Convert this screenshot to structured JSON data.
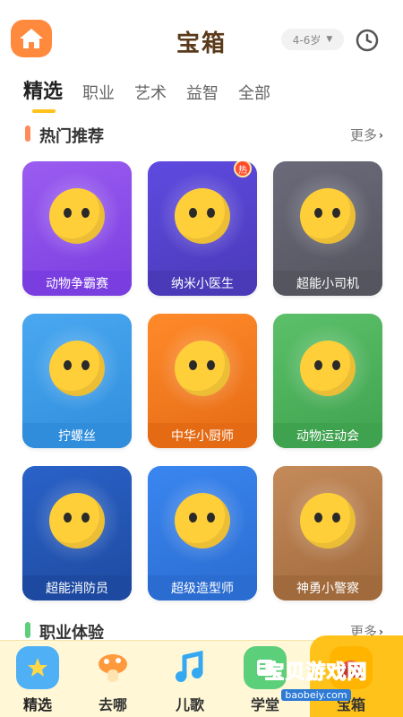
{
  "header": {
    "title": "宝箱",
    "age_filter": "4-6岁",
    "home_icon": "home-icon",
    "clock_icon": "clock-icon"
  },
  "tabs": [
    {
      "label": "精选",
      "active": true
    },
    {
      "label": "职业",
      "active": false
    },
    {
      "label": "艺术",
      "active": false
    },
    {
      "label": "益智",
      "active": false
    },
    {
      "label": "全部",
      "active": false
    }
  ],
  "sections": {
    "hot": {
      "title": "热门推荐",
      "more": "更多",
      "accent": "#ff8a5c"
    },
    "career": {
      "title": "职业体验",
      "more": "更多",
      "accent": "#5ccf7a"
    }
  },
  "cards": [
    {
      "label": "动物争霸赛",
      "bg": "#9b5cf0",
      "bar": "#7a3ee0",
      "badge": ""
    },
    {
      "label": "纳米小医生",
      "bg": "#5f4ae0",
      "bar": "#4a3ab8",
      "badge": "热"
    },
    {
      "label": "超能小司机",
      "bg": "#6a6a7a",
      "bar": "#55555f",
      "badge": ""
    },
    {
      "label": "拧螺丝",
      "bg": "#49a8f0",
      "bar": "#2f8ddc",
      "badge": ""
    },
    {
      "label": "中华小厨师",
      "bg": "#ff8a2a",
      "bar": "#e56a14",
      "badge": ""
    },
    {
      "label": "动物运动会",
      "bg": "#5cc06a",
      "bar": "#3fa24e",
      "badge": ""
    },
    {
      "label": "超能消防员",
      "bg": "#2a62c8",
      "bar": "#1d4aa0",
      "badge": ""
    },
    {
      "label": "超级造型师",
      "bg": "#3a86f0",
      "bar": "#2a6cd0",
      "badge": ""
    },
    {
      "label": "神勇小警察",
      "bg": "#c48a5a",
      "bar": "#a06a3c",
      "badge": ""
    }
  ],
  "bottom_nav": [
    {
      "label": "精选",
      "icon": "star-icon",
      "color": "#4fb0f5",
      "active": true
    },
    {
      "label": "去哪",
      "icon": "mushroom-icon",
      "color": "#ff9a3c",
      "active": false
    },
    {
      "label": "儿歌",
      "icon": "music-note-icon",
      "color": "#34a8f0",
      "active": false
    },
    {
      "label": "学堂",
      "icon": "book-icon",
      "color": "#5ccf7a",
      "active": false
    },
    {
      "label": "宝箱",
      "icon": "treasure-box-icon",
      "color": "#ffc21a",
      "active": false
    }
  ],
  "watermark": {
    "main": "宝贝游戏网",
    "sub": "baobeiy.com"
  }
}
